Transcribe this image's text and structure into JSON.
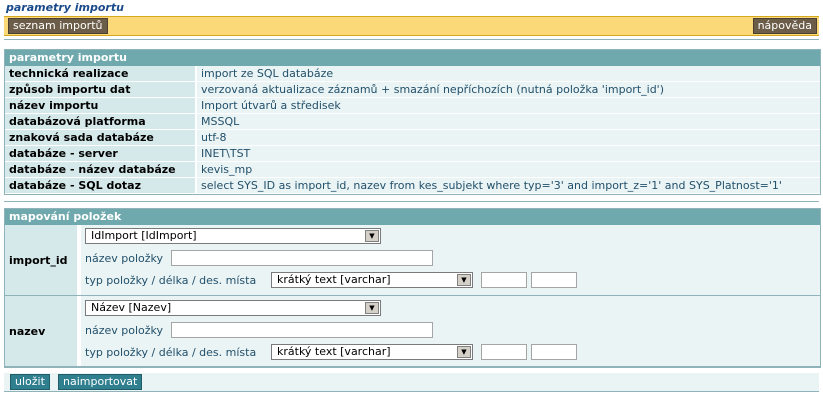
{
  "page_title": "parametry importu",
  "topbar": {
    "list_button": "seznam importů",
    "help_button": "nápověda"
  },
  "params_panel": {
    "title": "parametry importu",
    "rows": [
      {
        "key": "technická realizace",
        "value": "import ze SQL databáze"
      },
      {
        "key": "způsob importu dat",
        "value": "verzovaná aktualizace záznamů + smazání nepříchozích (nutná položka 'import_id')"
      },
      {
        "key": "název importu",
        "value": "Import útvarů a středisek"
      },
      {
        "key": "databázová platforma",
        "value": "MSSQL"
      },
      {
        "key": "znaková sada databáze",
        "value": "utf-8"
      },
      {
        "key": "databáze - server",
        "value": "INET\\TST"
      },
      {
        "key": "databáze - název databáze",
        "value": "kevis_mp"
      },
      {
        "key": "databáze - SQL dotaz",
        "value": "select SYS_ID as import_id, nazev from kes_subjekt where typ='3' and import_z='1' and SYS_Platnost='1'"
      }
    ]
  },
  "mapping_panel": {
    "title": "mapování položek",
    "items": [
      {
        "field": "import_id",
        "source_select": "IdImport [IdImport]",
        "name_label": "název položky",
        "name_value": "",
        "type_label": "typ položky / délka / des. místa",
        "type_select": "krátký text [varchar]",
        "length_value": "",
        "decimals_value": ""
      },
      {
        "field": "nazev",
        "source_select": "Název [Nazev]",
        "name_label": "název položky",
        "name_value": "",
        "type_label": "typ položky / délka / des. místa",
        "type_select": "krátký text [varchar]",
        "length_value": "",
        "decimals_value": ""
      }
    ]
  },
  "actions": {
    "save": "uložit",
    "import": "naimportovat"
  }
}
